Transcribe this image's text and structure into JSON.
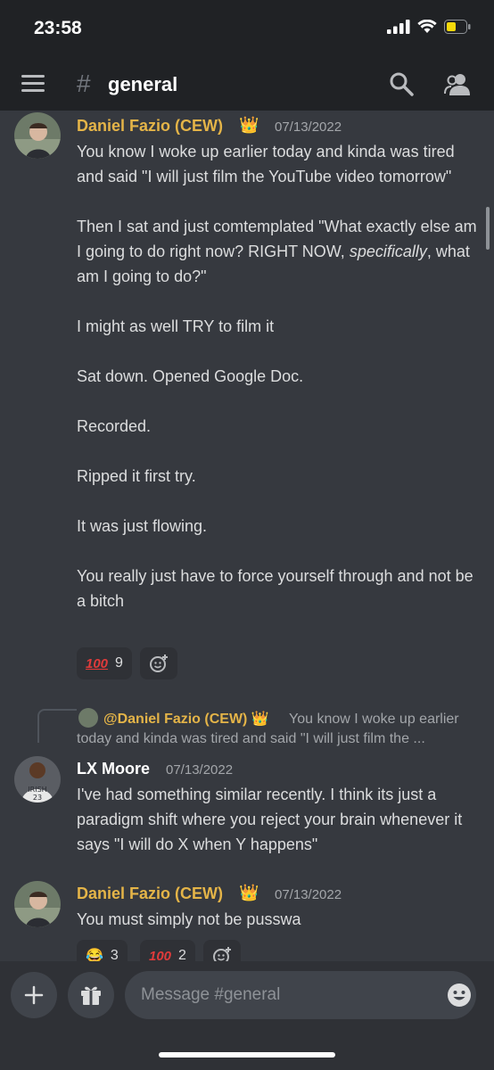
{
  "status": {
    "time": "23:58"
  },
  "header": {
    "channel_name": "general",
    "icons": [
      "menu-icon",
      "channel-hash-icon",
      "search-icon",
      "members-icon"
    ]
  },
  "messages": [
    {
      "author": "Daniel Fazio (CEW)",
      "badge": "👑",
      "timestamp": "07/13/2022",
      "paragraphs": [
        "You know I woke up earlier today and kinda was tired and said \"I will just film the YouTube video tomorrow\"",
        "",
        "I might as well TRY to film it",
        "Sat down. Opened Google Doc.",
        "Recorded.",
        "Ripped it first try.",
        "It was just flowing.",
        "You really just have to force yourself through and not be a bitch"
      ],
      "paragraph2_parts": [
        "Then I sat and just comtemplated \"What exactly else am I going to do right now? RIGHT NOW, ",
        "specifically",
        ", what am I going to do?\""
      ],
      "reactions": [
        {
          "emoji": "💯",
          "count": "9"
        }
      ]
    },
    {
      "reply_to": {
        "author": "@Daniel Fazio (CEW)",
        "badge": "👑",
        "line1": "You know I woke up earlier",
        "line2": "today and kinda was tired and said \"I will just film the ..."
      },
      "author": "LX Moore",
      "timestamp": "07/13/2022",
      "text": "I've had something similar recently. I think its just a paradigm shift where you reject your brain whenever it says \"I will do X when Y happens\""
    },
    {
      "author": "Daniel Fazio (CEW)",
      "badge": "👑",
      "timestamp": "07/13/2022",
      "text": "You must simply not be pusswa",
      "reactions": [
        {
          "emoji": "😂",
          "count": "3"
        },
        {
          "emoji": "💯",
          "count": "2"
        }
      ]
    }
  ],
  "composer": {
    "placeholder": "Message #general"
  },
  "colors": {
    "background": "#36393f",
    "header": "#202225",
    "gold_name": "#e4b448",
    "text": "#dcddde",
    "muted": "#a3a6aa"
  }
}
